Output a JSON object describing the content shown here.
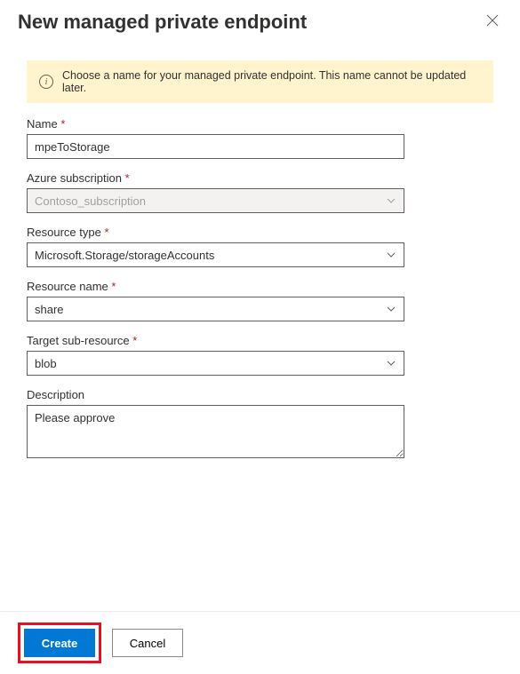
{
  "header": {
    "title": "New managed private endpoint"
  },
  "info": {
    "message": "Choose a name for your managed private endpoint. This name cannot be updated later."
  },
  "form": {
    "name": {
      "label": "Name",
      "value": "mpeToStorage",
      "required": "*"
    },
    "subscription": {
      "label": "Azure subscription",
      "value": "Contoso_subscription",
      "required": "*"
    },
    "resourceType": {
      "label": "Resource type",
      "value": "Microsoft.Storage/storageAccounts",
      "required": "*"
    },
    "resourceName": {
      "label": "Resource name",
      "value": "share",
      "required": "*"
    },
    "targetSubResource": {
      "label": "Target sub-resource",
      "value": "blob",
      "required": "*"
    },
    "description": {
      "label": "Description",
      "value": "Please approve"
    }
  },
  "footer": {
    "create": "Create",
    "cancel": "Cancel"
  }
}
